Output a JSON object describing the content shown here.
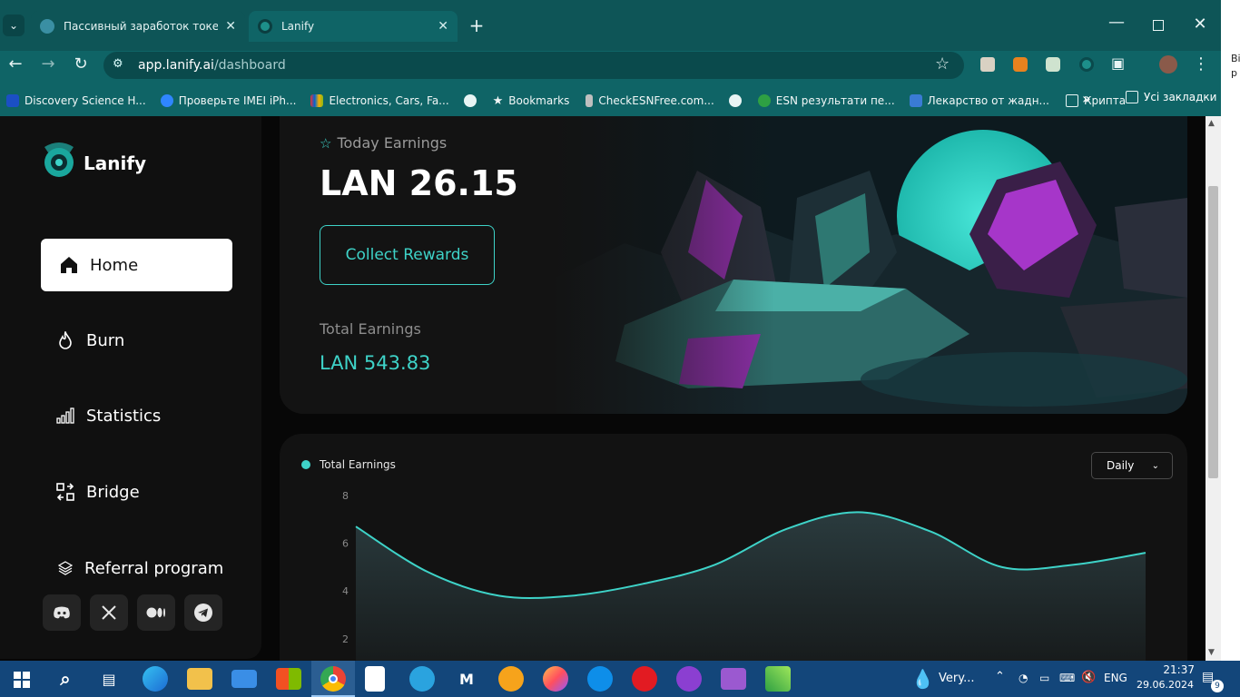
{
  "browser": {
    "tabs": [
      {
        "title": "Пассивный заработок токено",
        "active": false
      },
      {
        "title": "Lanify",
        "active": true
      }
    ],
    "url_host": "app.lanify.ai",
    "url_path": "/dashboard",
    "bookmarks": [
      {
        "label": "Discovery Science H..."
      },
      {
        "label": "Проверьте IMEI iPh..."
      },
      {
        "label": "Electronics, Cars, Fa..."
      },
      {
        "label": ""
      },
      {
        "label": "Bookmarks"
      },
      {
        "label": "CheckESNFree.com..."
      },
      {
        "label": ""
      },
      {
        "label": "ESN результати пе..."
      },
      {
        "label": "Лекарство от жадн..."
      },
      {
        "label": "Крипта"
      }
    ],
    "all_bookmarks_label": "Усі закладки",
    "more_glyph": "»"
  },
  "sidebar": {
    "logo_text": "Lanify",
    "items": [
      {
        "label": "Home",
        "active": true
      },
      {
        "label": "Burn",
        "active": false
      },
      {
        "label": "Statistics",
        "active": false
      },
      {
        "label": "Bridge",
        "active": false
      },
      {
        "label": "Referral program",
        "active": false
      }
    ]
  },
  "hero": {
    "today_label": "Today Earnings",
    "today_value": "LAN 26.15",
    "collect_label": "Collect Rewards",
    "total_label": "Total Earnings",
    "total_value": "LAN 543.83"
  },
  "chart": {
    "legend": "Total Earnings",
    "period_select": "Daily",
    "accent": "#3ed3c8"
  },
  "chart_data": {
    "type": "area",
    "series": [
      {
        "name": "Total Earnings",
        "values": [
          6.7,
          4.8,
          3.8,
          3.8,
          4.3,
          5.1,
          6.6,
          7.3,
          6.5,
          5.0,
          5.1,
          5.6
        ]
      }
    ],
    "ylim": [
      0,
      8
    ],
    "yticks": [
      2,
      4,
      6,
      8
    ],
    "grid": false,
    "legend_position": "top-left"
  },
  "taskbar": {
    "weather_text": "Very...",
    "lang": "ENG",
    "time": "21:37",
    "date": "29.06.2024",
    "notif_count": "9"
  },
  "right_edge": {
    "text_top": "Ві",
    "text_bottom": "р"
  }
}
